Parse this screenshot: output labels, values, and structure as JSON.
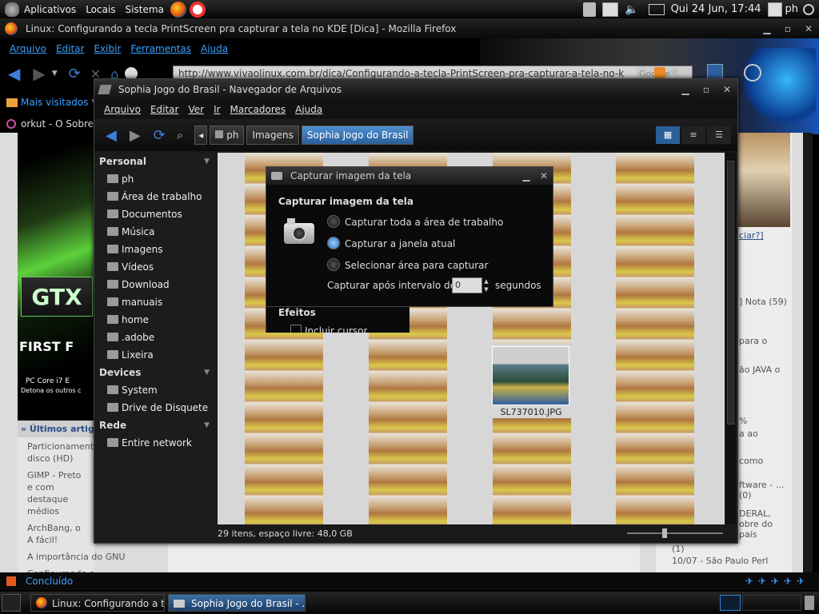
{
  "top_panel": {
    "menus": [
      "Aplicativos",
      "Locais",
      "Sistema"
    ],
    "clock": "Qui 24 Jun, 17:44",
    "user": "ph"
  },
  "firefox": {
    "title": "Linux: Configurando a tecla PrintScreen pra capturar a tela no KDE [Dica] - Mozilla Firefox",
    "menus": [
      "Arquivo",
      "Editar",
      "Exibir",
      "Ferramentas",
      "Ajuda"
    ],
    "url": "http://www.vivaolinux.com.br/dica/Configurando-a-tecla-PrintScreen-pra-capturar-a-tela-no-k",
    "search_hint": "Google",
    "bookmark": "Mais visitados",
    "tab_label": "orkut - O Sobre",
    "status": "Concluído"
  },
  "webpage": {
    "banner_text": "FIRST F",
    "banner_sub1": "PC Core i7 E",
    "banner_sub2": "Detona os outros c",
    "section_title": "» Últimos artigos",
    "articles": [
      "Particionamento disco (HD)",
      "GIMP - Preto e com destaque médios",
      "ArchBang, o A fácil!",
      "A importância do GNU",
      "Configurando o"
    ],
    "right_link": "ciar?]",
    "right_items": [
      "] Nota (59)",
      "para o",
      "ão JAVA o",
      "%",
      "a ao",
      "como",
      "ftware - ... (0)",
      "DERAL, obre do país",
      "(1)",
      "10/07 - São Paulo Perl"
    ]
  },
  "nautilus": {
    "title": "Sophia Jogo do Brasil - Navegador de Arquivos",
    "menus": [
      "Arquivo",
      "Editar",
      "Ver",
      "Ir",
      "Marcadores",
      "Ajuda"
    ],
    "breadcrumbs": [
      "ph",
      "Imagens",
      "Sophia Jogo do Brasil"
    ],
    "sidebar": {
      "personal_header": "Personal",
      "personal": [
        "ph",
        "Área de trabalho",
        "Documentos",
        "Música",
        "Imagens",
        "Vídeos",
        "Download",
        "manuais",
        "home",
        ".adobe",
        "Lixeira"
      ],
      "devices_header": "Devices",
      "devices": [
        "System",
        "Drive de Disquete"
      ],
      "network_header": "Rede",
      "network": [
        "Entire network"
      ]
    },
    "file_label": "SL737010.JPG",
    "status": "29 itens, espaço livre: 48,0 GB"
  },
  "dialog": {
    "title": "Capturar imagem da tela",
    "heading": "Capturar imagem da tela",
    "options": [
      "Capturar toda a área de trabalho",
      "Capturar a janela atual",
      "Selecionar área para capturar"
    ],
    "selected_index": 1,
    "delay_label": "Capturar após intervalo de",
    "delay_value": "0",
    "delay_unit": "segundos",
    "effects_heading": "Efeitos",
    "effect_option": "Incluir cursor"
  },
  "bottom_panel": {
    "tasks": [
      "Linux: Configurando a t...",
      "Sophia Jogo do Brasil - ..."
    ]
  },
  "colors": {
    "accent_blue": "#3aa0ff",
    "selection": "#2a5f9a"
  }
}
